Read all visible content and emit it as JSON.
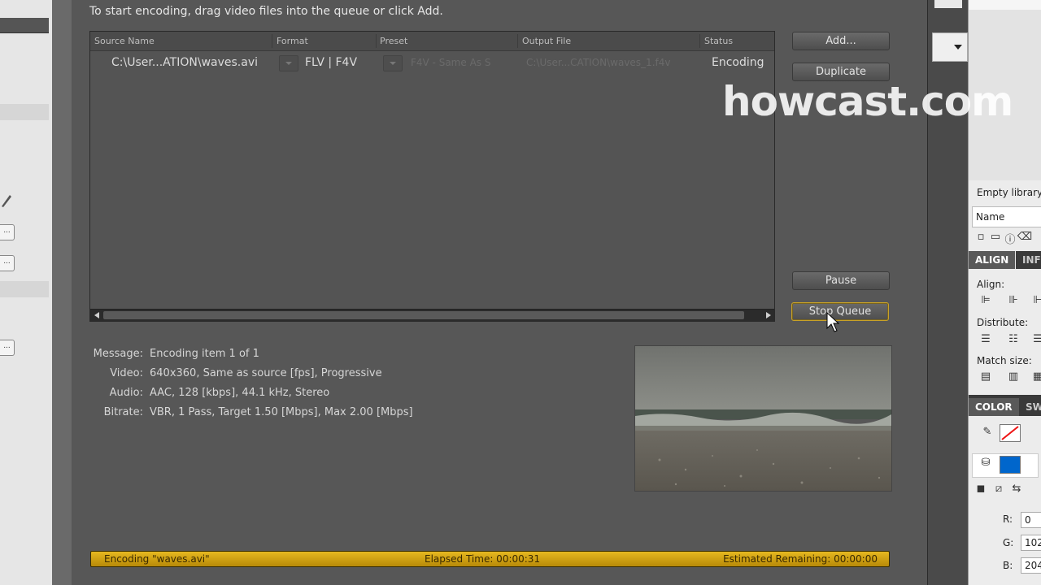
{
  "encoder": {
    "instruction": "To start encoding, drag video files into the queue or click Add.",
    "columns": {
      "source": "Source Name",
      "format": "Format",
      "preset": "Preset",
      "output": "Output File",
      "status": "Status"
    },
    "queue_item": {
      "source": "C:\\User...ATION\\waves.avi",
      "format": "FLV | F4V",
      "preset": "F4V - Same As S",
      "output": "C:\\User...CATION\\waves_1.f4v",
      "status": "Encoding"
    },
    "buttons": {
      "add": "Add...",
      "duplicate": "Duplicate",
      "pause": "Pause",
      "stop_queue": "Stop Queue"
    },
    "info": {
      "message_label": "Message:",
      "message_value": "Encoding item 1 of 1",
      "video_label": "Video:",
      "video_value": "640x360, Same as source [fps], Progressive",
      "audio_label": "Audio:",
      "audio_value": "AAC, 128 [kbps], 44.1 kHz, Stereo",
      "bitrate_label": "Bitrate:",
      "bitrate_value": "VBR, 1 Pass, Target 1.50 [Mbps], Max 2.00 [Mbps]"
    },
    "progress": {
      "encoding": "Encoding \"waves.avi\"",
      "elapsed": "Elapsed Time: 00:00:31",
      "remaining": "Estimated Remaining: 00:00:00"
    }
  },
  "right_panel": {
    "library_label": "Empty library",
    "name_header": "Name",
    "align_tab": "ALIGN",
    "info_tab": "INFO",
    "align_label": "Align:",
    "distribute_label": "Distribute:",
    "match_size_label": "Match size:",
    "color_tab": "COLOR",
    "swatches_tab": "SW",
    "r_label": "R:",
    "r_value": "0",
    "g_label": "G:",
    "g_value": "102",
    "b_label": "B:",
    "b_value": "204",
    "fill_color": "#0066cc"
  },
  "watermark": "howcast.com"
}
